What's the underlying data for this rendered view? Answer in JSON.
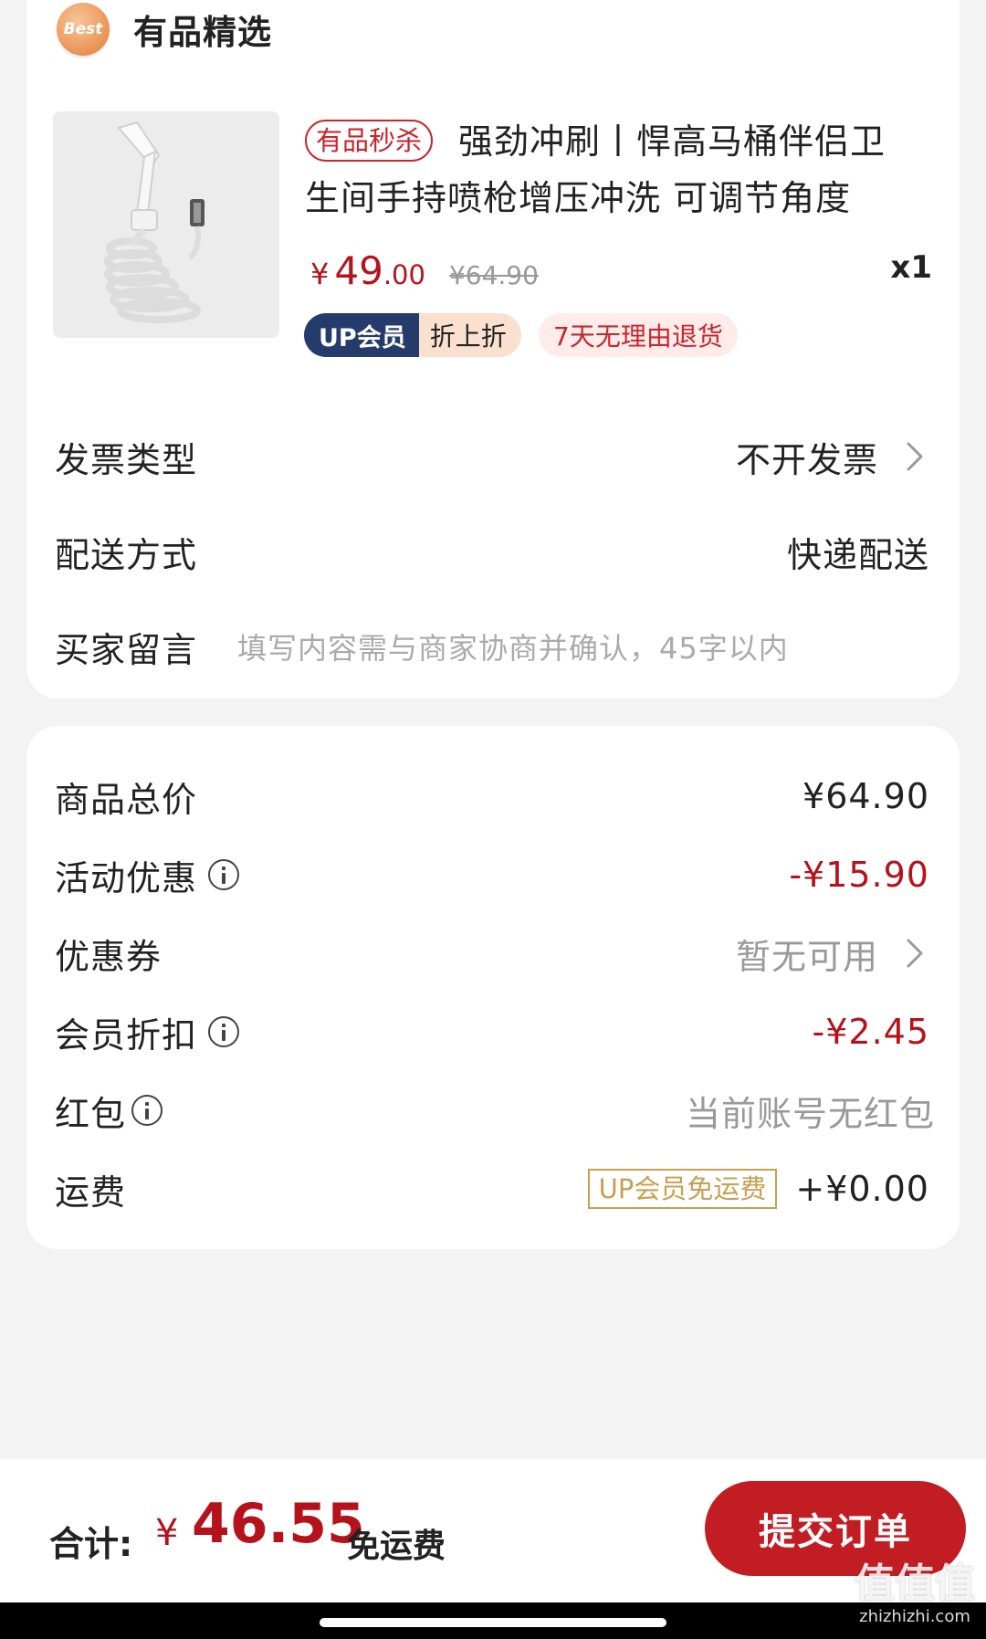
{
  "store": {
    "badge_text": "Best",
    "name": "有品精选"
  },
  "product": {
    "flash_tag": "有品秒杀",
    "title": "强劲冲刷丨悍高马桶伴侣卫生间手持喷枪增压冲洗 可调节角度",
    "price_currency": "¥",
    "price_int": "49",
    "price_dec": ".00",
    "original_price": "¥64.90",
    "quantity": "x1",
    "up_member_label": "UP会员",
    "up_discount_label": "折上折",
    "return_policy": "7天无理由退货"
  },
  "options": {
    "invoice_label": "发票类型",
    "invoice_value": "不开发票",
    "delivery_label": "配送方式",
    "delivery_value": "快递配送",
    "message_label": "买家留言",
    "message_placeholder": "填写内容需与商家协商并确认，45字以内"
  },
  "summary": {
    "subtotal_label": "商品总价",
    "subtotal_value": "¥64.90",
    "promo_label": "活动优惠",
    "promo_value": "-¥15.90",
    "coupon_label": "优惠券",
    "coupon_value": "暂无可用",
    "member_discount_label": "会员折扣",
    "member_discount_value": "-¥2.45",
    "redpacket_label": "红包",
    "redpacket_value": "当前账号无红包",
    "shipping_label": "运费",
    "shipping_badge": "UP会员免运费",
    "shipping_value": "+¥0.00"
  },
  "footer": {
    "total_label": "合计:",
    "total_currency": "¥",
    "total_amount": "46.55",
    "shipping_note": "免运费",
    "submit_label": "提交订单"
  },
  "watermark": {
    "text": "值值值",
    "site": "zhizhizhi.com"
  },
  "colors": {
    "accent_red": "#b5121b",
    "button_red": "#c31d24",
    "up_navy": "#243b6b",
    "gold": "#c9a04f"
  }
}
